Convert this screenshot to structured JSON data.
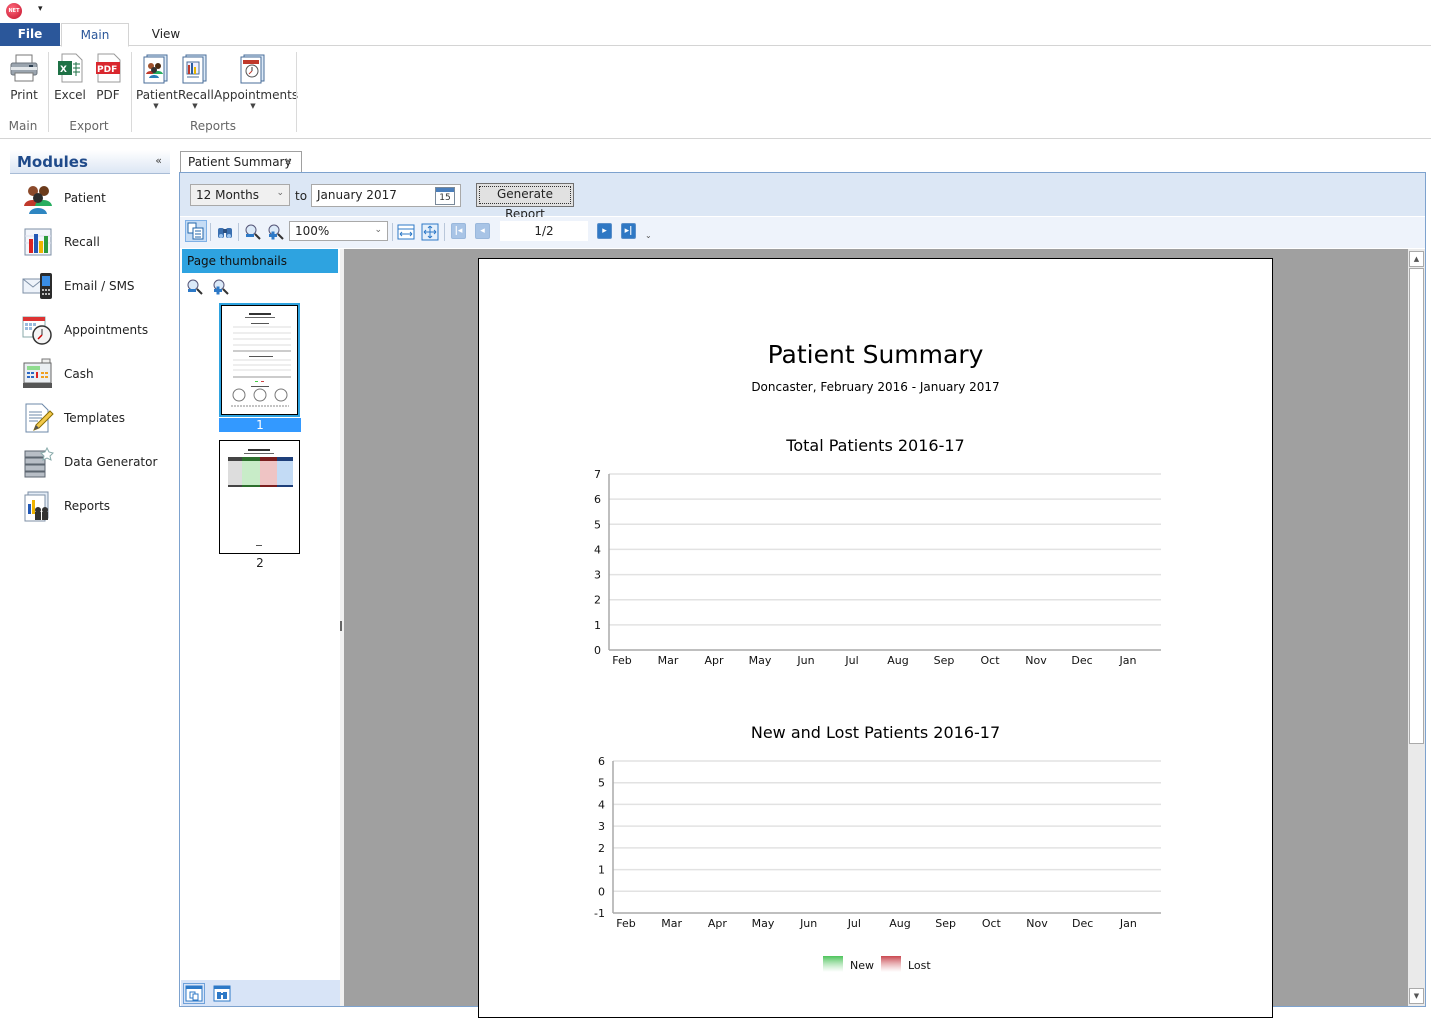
{
  "app": {
    "logo_text": "NET",
    "qat_menu_glyph": "▾"
  },
  "ribbon": {
    "tabs": [
      {
        "label": "File"
      },
      {
        "label": "Main"
      },
      {
        "label": "View"
      }
    ],
    "active_tab": "Main",
    "buttons": {
      "print": "Print",
      "excel": "Excel",
      "pdf": "PDF",
      "patient": "Patient",
      "recall": "Recall",
      "appointments": "Appointments"
    },
    "groups": {
      "main": "Main",
      "export": "Export",
      "reports": "Reports"
    }
  },
  "modules": {
    "title": "Modules",
    "collapse_glyph": "«",
    "items": [
      {
        "label": "Patient",
        "icon": "patient-icon"
      },
      {
        "label": "Recall",
        "icon": "recall-chart-icon"
      },
      {
        "label": "Email / SMS",
        "icon": "email-sms-icon"
      },
      {
        "label": "Appointments",
        "icon": "appointments-icon"
      },
      {
        "label": "Cash",
        "icon": "cash-register-icon"
      },
      {
        "label": "Templates",
        "icon": "templates-icon"
      },
      {
        "label": "Data Generator",
        "icon": "data-generator-icon"
      },
      {
        "label": "Reports",
        "icon": "reports-icon"
      }
    ]
  },
  "document_tab": {
    "label": "Patient Summary",
    "close_glyph": "x"
  },
  "params": {
    "period": "12 Months",
    "to_label": "to",
    "end_date": "January 2017",
    "calendar_day": "15",
    "generate_label": "Generate Report"
  },
  "preview_toolbar": {
    "zoom": "100%",
    "page_indicator": "1/2"
  },
  "thumbnails": {
    "header": "Page thumbnails",
    "pages": [
      {
        "number": "1",
        "selected": true
      },
      {
        "number": "2",
        "selected": false
      }
    ]
  },
  "report": {
    "title": "Patient Summary",
    "subtitle": "Doncaster, February 2016 - January 2017"
  },
  "chart_data": [
    {
      "type": "bar",
      "title": "Total Patients 2016-17",
      "categories": [
        "Feb",
        "Mar",
        "Apr",
        "May",
        "Jun",
        "Jul",
        "Aug",
        "Sep",
        "Oct",
        "Nov",
        "Dec",
        "Jan"
      ],
      "series": [],
      "ylim": [
        0,
        7
      ],
      "yticks": [
        0,
        1,
        2,
        3,
        4,
        5,
        6,
        7
      ],
      "grid": true,
      "xlabel": "",
      "ylabel": ""
    },
    {
      "type": "bar",
      "title": "New and Lost Patients 2016-17",
      "categories": [
        "Feb",
        "Mar",
        "Apr",
        "May",
        "Jun",
        "Jul",
        "Aug",
        "Sep",
        "Oct",
        "Nov",
        "Dec",
        "Jan"
      ],
      "series": [
        {
          "name": "New",
          "color": "#4cc35a",
          "values": []
        },
        {
          "name": "Lost",
          "color": "#c9474f",
          "values": []
        }
      ],
      "ylim": [
        -1,
        6
      ],
      "yticks": [
        -1,
        0,
        1,
        2,
        3,
        4,
        5,
        6
      ],
      "grid": true,
      "legend": "bottom-center",
      "xlabel": "",
      "ylabel": ""
    }
  ]
}
